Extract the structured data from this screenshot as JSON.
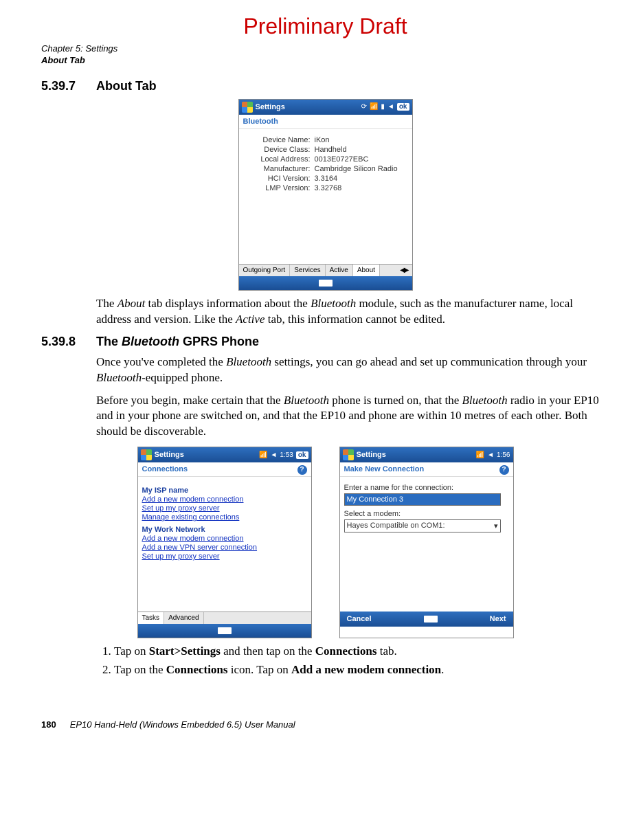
{
  "watermark": "Preliminary Draft",
  "header": {
    "chapter": "Chapter 5: Settings",
    "section": "About Tab"
  },
  "sec1": {
    "number": "5.39.7",
    "title": "About Tab",
    "para_parts": {
      "p1a": "The ",
      "p1b": "About",
      "p1c": " tab displays information about the ",
      "p1d": "Bluetooth",
      "p1e": " module, such as the manufacturer name, local address and version. Like the ",
      "p1f": "Active",
      "p1g": " tab, this information cannot be edited."
    }
  },
  "sec2": {
    "number": "5.39.8",
    "title_a": "The ",
    "title_b": "Bluetooth",
    "title_c": " GPRS Phone",
    "p1": {
      "a": "Once you've completed the ",
      "b": "Bluetooth",
      "c": " settings, you can go ahead and set up communication through your ",
      "d": "Bluetooth",
      "e": "-equipped phone."
    },
    "p2": {
      "a": "Before you begin, make certain that the ",
      "b": "Bluetooth",
      "c": " phone is turned on, that the ",
      "d": "Bluetooth",
      "e": " radio in your EP10 and in your phone are switched on, and that the EP10 and phone are within 10 metres of each other. Both should be discoverable."
    },
    "step1": {
      "a": "Tap on ",
      "b": "Start>Settings",
      "c": " and then tap on the ",
      "d": "Connections",
      "e": " tab."
    },
    "step2": {
      "a": "Tap on the ",
      "b": "Connections",
      "c": " icon. Tap on ",
      "d": "Add a new modem connection",
      "e": "."
    }
  },
  "shot_about": {
    "title": "Settings",
    "sub": "Bluetooth",
    "kv": [
      {
        "k": "Device Name:",
        "v": "iKon"
      },
      {
        "k": "Device Class:",
        "v": "Handheld"
      },
      {
        "k": "Local Address:",
        "v": "0013E0727EBC"
      },
      {
        "k": "Manufacturer:",
        "v": "Cambridge Silicon Radio"
      },
      {
        "k": "HCI Version:",
        "v": "3.3164"
      },
      {
        "k": "LMP Version:",
        "v": "3.32768"
      }
    ],
    "tabs": [
      "Outgoing Port",
      "Services",
      "Active",
      "About"
    ],
    "active_tab": "About",
    "ok": "ok"
  },
  "shot_conn": {
    "title": "Settings",
    "time": "1:53",
    "sub": "Connections",
    "sec1_title": "My ISP name",
    "sec1_links": [
      "Add a new modem connection",
      "Set up my proxy server",
      "Manage existing connections"
    ],
    "sec2_title": "My Work Network",
    "sec2_links": [
      "Add a new modem connection",
      "Add a new VPN server connection",
      "Set up my proxy server"
    ],
    "tabs": [
      "Tasks",
      "Advanced"
    ],
    "active_tab": "Tasks",
    "ok": "ok"
  },
  "shot_new": {
    "title": "Settings",
    "time": "1:56",
    "sub": "Make New Connection",
    "label1": "Enter a name for the connection:",
    "value1": "My Connection 3",
    "label2": "Select a modem:",
    "value2": "Hayes Compatible on COM1:",
    "soft_left": "Cancel",
    "soft_right": "Next"
  },
  "footer": {
    "page": "180",
    "text": "EP10 Hand-Held (Windows Embedded 6.5) User Manual"
  }
}
